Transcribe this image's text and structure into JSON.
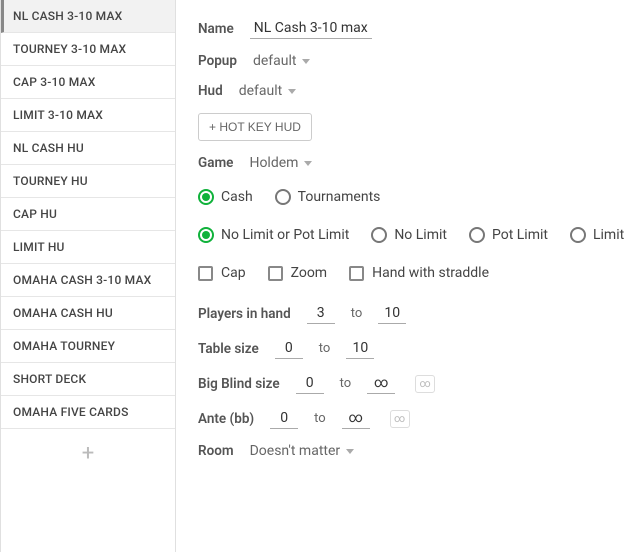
{
  "sidebar": {
    "items": [
      {
        "label": "NL CASH 3-10 MAX",
        "selected": true
      },
      {
        "label": "TOURNEY 3-10 MAX",
        "selected": false
      },
      {
        "label": "CAP 3-10 MAX",
        "selected": false
      },
      {
        "label": "LIMIT 3-10 MAX",
        "selected": false
      },
      {
        "label": "NL CASH HU",
        "selected": false
      },
      {
        "label": "TOURNEY HU",
        "selected": false
      },
      {
        "label": "CAP HU",
        "selected": false
      },
      {
        "label": "LIMIT HU",
        "selected": false
      },
      {
        "label": "OMAHA CASH 3-10 MAX",
        "selected": false
      },
      {
        "label": "OMAHA CASH HU",
        "selected": false
      },
      {
        "label": "OMAHA TOURNEY",
        "selected": false
      },
      {
        "label": "SHORT DECK",
        "selected": false
      },
      {
        "label": "OMAHA FIVE CARDS",
        "selected": false
      }
    ],
    "add_icon": "+"
  },
  "form": {
    "name_label": "Name",
    "name_value": "NL Cash 3-10 max",
    "popup_label": "Popup",
    "popup_value": "default",
    "hud_label": "Hud",
    "hud_value": "default",
    "hotkey_button": "+ HOT KEY HUD",
    "game_label": "Game",
    "game_value": "Holdem",
    "type_options": [
      {
        "label": "Cash",
        "checked": true
      },
      {
        "label": "Tournaments",
        "checked": false
      }
    ],
    "limit_options": [
      {
        "label": "No Limit or Pot Limit",
        "checked": true
      },
      {
        "label": "No Limit",
        "checked": false
      },
      {
        "label": "Pot Limit",
        "checked": false
      },
      {
        "label": "Limit",
        "checked": false
      }
    ],
    "flags": [
      {
        "label": "Cap",
        "checked": false
      },
      {
        "label": "Zoom",
        "checked": false
      },
      {
        "label": "Hand with straddle",
        "checked": false
      }
    ],
    "players_label": "Players in hand",
    "players_from": "3",
    "players_to_word": "to",
    "players_to": "10",
    "table_label": "Table size",
    "table_from": "0",
    "table_to": "10",
    "bb_label": "Big Blind size",
    "bb_from": "0",
    "bb_to": "∞",
    "ante_label": "Ante (bb)",
    "ante_from": "0",
    "ante_to": "∞",
    "inf_symbol": "∞",
    "room_label": "Room",
    "room_value": "Doesn't matter"
  }
}
